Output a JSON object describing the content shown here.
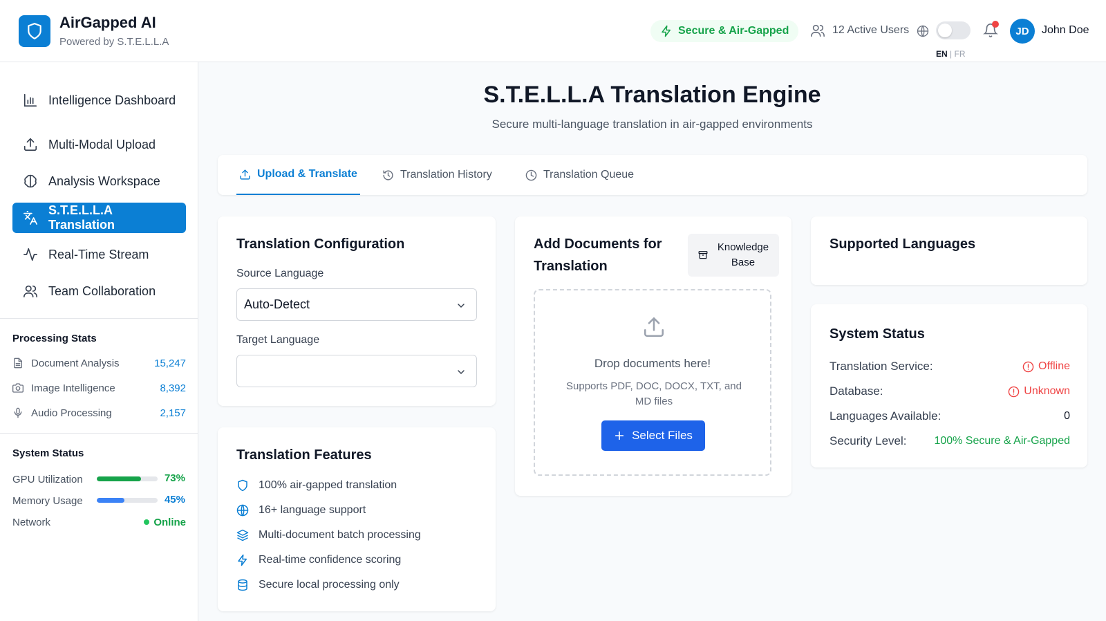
{
  "header": {
    "app_title": "AirGapped AI",
    "app_subtitle": "Powered by S.T.E.L.L.A",
    "secure_badge": "Secure & Air-Gapped",
    "active_users": "12 Active Users",
    "lang_en": "EN",
    "lang_sep": "|",
    "lang_fr": "FR",
    "avatar_initials": "JD",
    "user_name": "John Doe"
  },
  "sidebar": {
    "nav": [
      {
        "label": "Intelligence Dashboard",
        "icon": "bar-chart-icon"
      },
      {
        "label": "Multi-Modal Upload",
        "icon": "upload-icon"
      },
      {
        "label": "Analysis Workspace",
        "icon": "brain-icon"
      },
      {
        "label": "S.T.E.L.L.A Translation",
        "icon": "languages-icon"
      },
      {
        "label": "Real-Time Stream",
        "icon": "activity-icon"
      },
      {
        "label": "Team Collaboration",
        "icon": "users-icon"
      }
    ],
    "processing_stats": {
      "heading": "Processing Stats",
      "items": [
        {
          "label": "Document Analysis",
          "value": "15,247"
        },
        {
          "label": "Image Intelligence",
          "value": "8,392"
        },
        {
          "label": "Audio Processing",
          "value": "2,157"
        }
      ]
    },
    "system_status": {
      "heading": "System Status",
      "gpu_label": "GPU Utilization",
      "gpu_value": "73%",
      "gpu_fraction": 0.73,
      "memory_label": "Memory Usage",
      "memory_value": "45%",
      "memory_fraction": 0.45,
      "network_label": "Network",
      "network_value": "Online"
    }
  },
  "main": {
    "title": "S.T.E.L.L.A Translation Engine",
    "subtitle": "Secure multi-language translation in air-gapped environments",
    "tabs": [
      {
        "label": "Upload & Translate",
        "active": true
      },
      {
        "label": "Translation History",
        "active": false
      },
      {
        "label": "Translation Queue",
        "active": false
      }
    ],
    "config": {
      "title": "Translation Configuration",
      "source_label": "Source Language",
      "source_value": "Auto-Detect",
      "target_label": "Target Language",
      "target_value": ""
    },
    "features": {
      "title": "Translation Features",
      "items": [
        "100% air-gapped translation",
        "16+ language support",
        "Multi-document batch processing",
        "Real-time confidence scoring",
        "Secure local processing only"
      ]
    },
    "documents": {
      "title_line1": "Add Documents for",
      "title_line2": "Translation",
      "kb_line1": "Knowledge",
      "kb_line2": "Base",
      "drop_title": "Drop documents here!",
      "drop_sub": "Supports PDF, DOC, DOCX, TXT, and MD files",
      "select_button": "Select Files"
    },
    "supported": {
      "title": "Supported Languages"
    },
    "status": {
      "title": "System Status",
      "rows": [
        {
          "label": "Translation Service:",
          "value": "Offline"
        },
        {
          "label": "Database:",
          "value": "Unknown"
        },
        {
          "label": "Languages Available:",
          "value": "0"
        },
        {
          "label": "Security Level:",
          "value": "100% Secure & Air-Gapped"
        }
      ]
    }
  },
  "colors": {
    "primary": "#0b7fd4",
    "button": "#1e63e9",
    "success": "#16a34a",
    "danger": "#ef4444",
    "memory_bar": "#3b82f6"
  }
}
